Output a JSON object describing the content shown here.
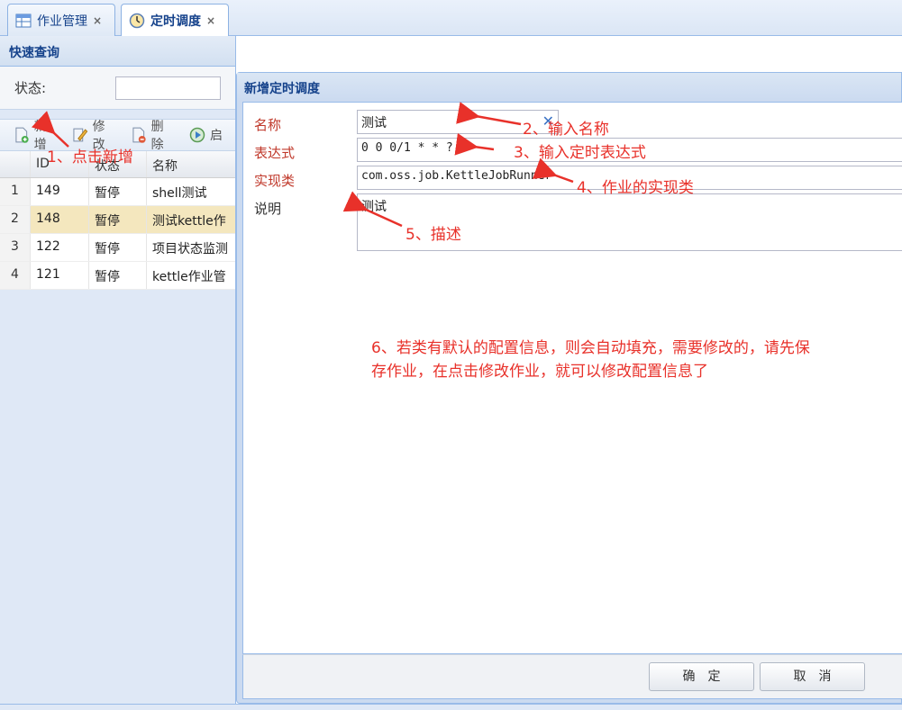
{
  "tabs": [
    {
      "label": "作业管理",
      "icon": "table-icon"
    },
    {
      "label": "定时调度",
      "icon": "clock-icon"
    }
  ],
  "tab_close": "×",
  "quick_search": {
    "title": "快速查询",
    "status_label": "状态:"
  },
  "toolbar": {
    "add": "新增",
    "edit": "修改",
    "delete": "删除",
    "start": "启"
  },
  "grid": {
    "headers": [
      "",
      "ID",
      "状态",
      "名称"
    ],
    "rows": [
      {
        "no": "1",
        "id": "149",
        "status": "暂停",
        "name": "shell测试"
      },
      {
        "no": "2",
        "id": "148",
        "status": "暂停",
        "name": "测试kettle作"
      },
      {
        "no": "3",
        "id": "122",
        "status": "暂停",
        "name": "项目状态监测"
      },
      {
        "no": "4",
        "id": "121",
        "status": "暂停",
        "name": "kettle作业管"
      }
    ]
  },
  "dialog": {
    "title": "新增定时调度",
    "fields": {
      "name_label": "名称",
      "name_value": "测试",
      "expr_label": "表达式",
      "expr_value": "0 0 0/1 * * ?",
      "impl_label": "实现类",
      "impl_value": "com.oss.job.KettleJobRunner",
      "desc_label": "说明",
      "desc_value": "测试"
    },
    "ok": "确定",
    "cancel": "取消"
  },
  "annotations": {
    "a1": "1、点击新增",
    "a2": "2、输入名称",
    "a3": "3、输入定时表达式",
    "a4": "4、作业的实现类",
    "a5": "5、描述",
    "a6_line1": "6、若类有默认的配置信息，则会自动填充，需要修改的，请先保",
    "a6_line2": "存作业，在点击修改作业，就可以修改配置信息了"
  },
  "colors": {
    "annotation": "#e8312a",
    "required_label": "#c0392b",
    "selected_row": "#f4e7be",
    "header_text": "#15428b"
  }
}
